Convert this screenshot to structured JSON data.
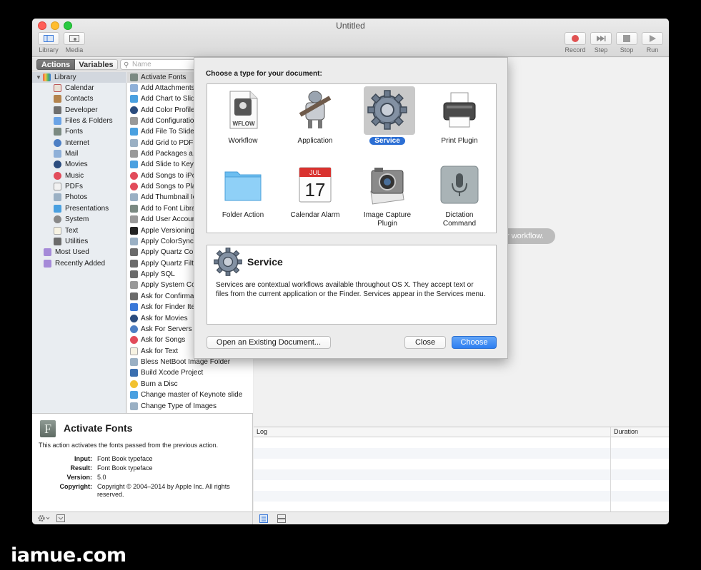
{
  "window": {
    "title": "Untitled"
  },
  "toolbar": {
    "library_label": "Library",
    "media_label": "Media",
    "record_label": "Record",
    "step_label": "Step",
    "stop_label": "Stop",
    "run_label": "Run"
  },
  "left_header": {
    "actions_tab": "Actions",
    "variables_tab": "Variables",
    "search_placeholder": "Name"
  },
  "library": {
    "root": "Library",
    "items": [
      "Calendar",
      "Contacts",
      "Developer",
      "Files & Folders",
      "Fonts",
      "Internet",
      "Mail",
      "Movies",
      "Music",
      "PDFs",
      "Photos",
      "Presentations",
      "System",
      "Text",
      "Utilities"
    ],
    "smart": [
      "Most Used",
      "Recently Added"
    ]
  },
  "actions": [
    "Activate Fonts",
    "Add Attachments",
    "Add Chart to Slid",
    "Add Color Profile",
    "Add Configuration",
    "Add File To Slide",
    "Add Grid to PDF",
    "Add Packages a...",
    "Add Slide to Keyn",
    "Add Songs to iPo",
    "Add Songs to Pla",
    "Add Thumbnail Ic",
    "Add to Font Libra",
    "Add User Accoun",
    "Apple Versioning",
    "Apply ColorSync",
    "Apply Quartz Co...",
    "Apply Quartz Filt...",
    "Apply SQL",
    "Apply System Con",
    "Ask for Confirmat",
    "Ask for Finder Ite",
    "Ask for Movies",
    "Ask For Servers",
    "Ask for Songs",
    "Ask for Text",
    "Bless NetBoot Image Folder",
    "Build Xcode Project",
    "Burn a Disc",
    "Change master of Keynote slide",
    "Change Type of Images"
  ],
  "description": {
    "title": "Activate Fonts",
    "text": "This action activates the fonts passed from the previous action.",
    "input_label": "Input:",
    "input_value": "Font Book typeface",
    "result_label": "Result:",
    "result_value": "Font Book typeface",
    "version_label": "Version:",
    "version_value": "5.0",
    "copyright_label": "Copyright:",
    "copyright_value": "Copyright © 2004–2014 by Apple Inc. All rights reserved."
  },
  "workflow": {
    "hint": "r workflow."
  },
  "log": {
    "log_col": "Log",
    "duration_col": "Duration"
  },
  "sheet": {
    "prompt": "Choose a type for your document:",
    "types": [
      {
        "label": "Workflow"
      },
      {
        "label": "Application"
      },
      {
        "label": "Service"
      },
      {
        "label": "Print Plugin"
      },
      {
        "label": "Folder Action"
      },
      {
        "label": "Calendar Alarm"
      },
      {
        "label": "Image Capture\nPlugin"
      },
      {
        "label": "Dictation\nCommand"
      }
    ],
    "wflow_text": "WFLOW",
    "cal_month": "JUL",
    "cal_day": "17",
    "selected_title": "Service",
    "selected_desc": "Services are contextual workflows available throughout OS X. They accept text or files from the current application or the Finder. Services appear in the Services menu.",
    "open_existing": "Open an Existing Document...",
    "close": "Close",
    "choose": "Choose"
  },
  "watermark": "iamue.com",
  "colors": {
    "accent": "#2c6fd4",
    "record": "#e05252"
  }
}
